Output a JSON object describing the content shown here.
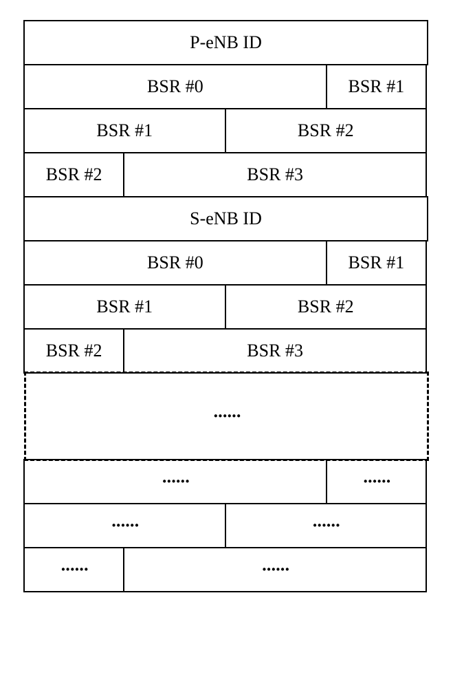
{
  "rows": {
    "p_enb_id": "P-eNB ID",
    "bsr0": "BSR #0",
    "bsr1": "BSR #1",
    "bsr2": "BSR #2",
    "bsr3": "BSR #3",
    "s_enb_id": "S-eNB ID",
    "ellipsis": "······"
  }
}
